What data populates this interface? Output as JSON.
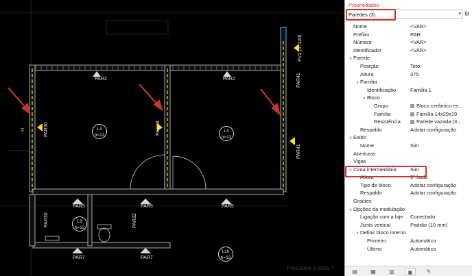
{
  "panel": {
    "title": "Propriedades",
    "selector_value": "Paredes (3)",
    "selector_icon": "filter-icon"
  },
  "properties": [
    {
      "depth": 0,
      "key": "Nome",
      "value": "<VAR>"
    },
    {
      "depth": 0,
      "key": "Prefixo",
      "value": "PAR"
    },
    {
      "depth": 0,
      "key": "Número",
      "value": "<VAR>"
    },
    {
      "depth": 0,
      "key": "Identificador",
      "value": "<VAR>"
    },
    {
      "depth": 0,
      "key": "Parede",
      "value": "",
      "toggle": "v"
    },
    {
      "depth": 1,
      "key": "Posição",
      "value": "Teto"
    },
    {
      "depth": 1,
      "key": "Altura",
      "value": "375"
    },
    {
      "depth": 1,
      "key": "Família",
      "value": "",
      "toggle": "v"
    },
    {
      "depth": 2,
      "key": "Identificação",
      "value": "Família 1"
    },
    {
      "depth": 2,
      "key": "Bloco",
      "value": "",
      "toggle": "v"
    },
    {
      "depth": 3,
      "key": "Grupo",
      "value": "Bloco cerâmico es...",
      "swatch": true
    },
    {
      "depth": 3,
      "key": "Família",
      "value": "Família 14x29x19",
      "swatch": true
    },
    {
      "depth": 3,
      "key": "Resistência",
      "value": "Parede vazada (3...",
      "swatch": true
    },
    {
      "depth": 1,
      "key": "Respaldo",
      "value": "Adotar configuração"
    },
    {
      "depth": 0,
      "key": "Exibir",
      "value": "",
      "toggle": "v"
    },
    {
      "depth": 1,
      "key": "Nome",
      "value": "Sim"
    },
    {
      "depth": 0,
      "key": "Aberturas",
      "value": ""
    },
    {
      "depth": 0,
      "key": "Vigas",
      "value": ""
    },
    {
      "depth": 0,
      "key": "Cinta intermediária",
      "value": "Sim",
      "toggle": "v"
    },
    {
      "depth": 1,
      "key": "Altura",
      "value": "9ª fiada"
    },
    {
      "depth": 1,
      "key": "Tipo de bloco",
      "value": "Adotar configuração"
    },
    {
      "depth": 1,
      "key": "Respaldo",
      "value": "Adotar configuração"
    },
    {
      "depth": 0,
      "key": "Grautes",
      "value": ""
    },
    {
      "depth": 0,
      "key": "Opções da modulação",
      "value": "",
      "toggle": "v"
    },
    {
      "depth": 1,
      "key": "Ligação com a laje",
      "value": "Conectado"
    },
    {
      "depth": 1,
      "key": "Junta vertical",
      "value": "Padrão (10 mm)"
    },
    {
      "depth": 1,
      "key": "Definir bloco interno",
      "value": "",
      "toggle": "v"
    },
    {
      "depth": 2,
      "key": "Primeiro",
      "value": "Automático"
    },
    {
      "depth": 2,
      "key": "Último",
      "value": "Automático"
    }
  ],
  "tabs": [
    {
      "name": "tab-properties",
      "icon": "▤"
    },
    {
      "name": "tab-layers",
      "icon": "▦"
    },
    {
      "name": "tab-elements",
      "icon": "▥"
    },
    {
      "name": "tab-views",
      "icon": "▣"
    },
    {
      "name": "tab-tools",
      "icon": "✎"
    }
  ],
  "drawing": {
    "wall_labels": [
      "PAR2",
      "PAR2",
      "PAR41",
      "PAR30",
      "PAR39",
      "PAR41",
      "PAR5",
      "PAR5",
      "PAR5",
      "PAR7",
      "PAR7",
      "PAR32",
      "PAR30",
      "PV2 (h=120)"
    ],
    "rooms": [
      {
        "name": "L3",
        "h": "h=12"
      },
      {
        "name": "L4",
        "h": "h=12"
      },
      {
        "name": "L9",
        "h": "h=12"
      },
      {
        "name": "L10",
        "h": "h=12"
      }
    ],
    "dim_label": "H",
    "hint": "Pressione a tecla ?"
  }
}
